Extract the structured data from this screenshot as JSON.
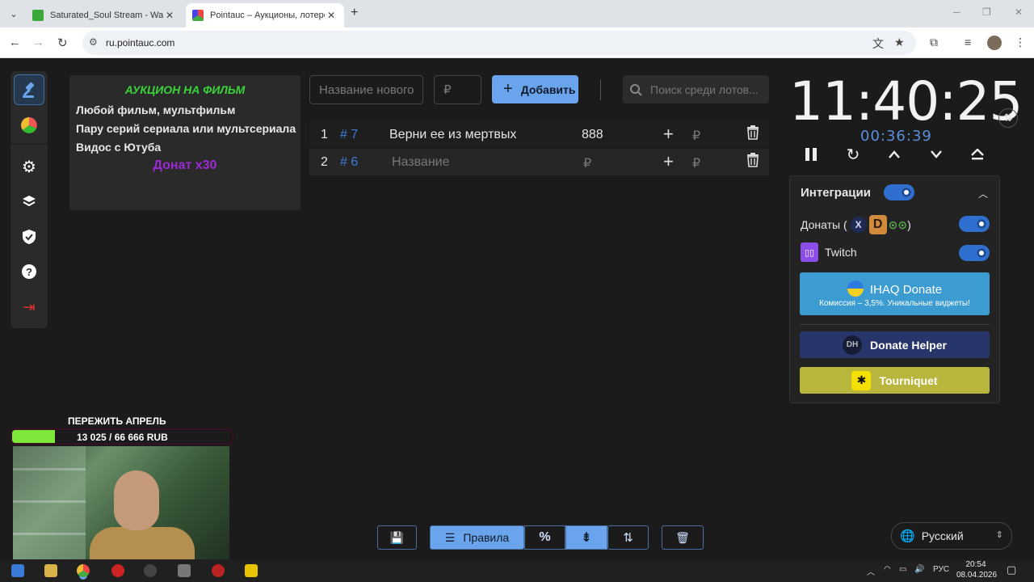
{
  "browser": {
    "tabs": [
      {
        "title": "Saturated_Soul Stream - Watch",
        "active": false
      },
      {
        "title": "Pointauc – Аукционы, лотереи",
        "active": true
      }
    ],
    "url": "ru.pointauc.com"
  },
  "rules": {
    "title": "АУКЦИОН НА ФИЛЬМ",
    "lines": [
      "Любой фильм, мультфильм",
      "Пару серий сериала или мультсериала",
      "Видос с Ютуба"
    ],
    "donate": "Донат х30"
  },
  "toolbar": {
    "name_placeholder": "Название нового",
    "amount_placeholder": "₽",
    "add_label": "Добавить",
    "search_placeholder": "Поиск среди лотов..."
  },
  "lots": [
    {
      "index": "1",
      "id": "# 7",
      "name": "Верни ее из мертвых",
      "amount": "888",
      "placeholder": false
    },
    {
      "index": "2",
      "id": "# 6",
      "name": "Название",
      "amount": "₽",
      "placeholder": true
    }
  ],
  "currency": "₽",
  "timer": {
    "main": "11:40:25",
    "sub": "00:36:39"
  },
  "integrations": {
    "title": "Интеграции",
    "donations_label": "Донаты (",
    "donations_close": ")",
    "twitch_label": "Twitch",
    "ihaq_title": "IHAQ Donate",
    "ihaq_sub": "Комиссия – 3,5%. Уникальные виджеты!",
    "dh_title": "Donate Helper",
    "dh_icon": "DH",
    "tq_title": "Tourniquet"
  },
  "overlay": {
    "goal_title": "ПЕРЕЖИТЬ АПРЕЛЬ",
    "goal_text": "13 025 / 66 666 RUB",
    "goal_fraction": 0.195
  },
  "bottom": {
    "rules_label": "Правила"
  },
  "language": "Русский",
  "taskbar": {
    "lang": "РУС",
    "time": "20:54",
    "date": "08.04.2026"
  },
  "colors": {
    "accent": "#6aa4ec",
    "rules_title": "#3ad43a",
    "donate": "#9b2ad6",
    "timer_sub": "#5a8fdc"
  }
}
